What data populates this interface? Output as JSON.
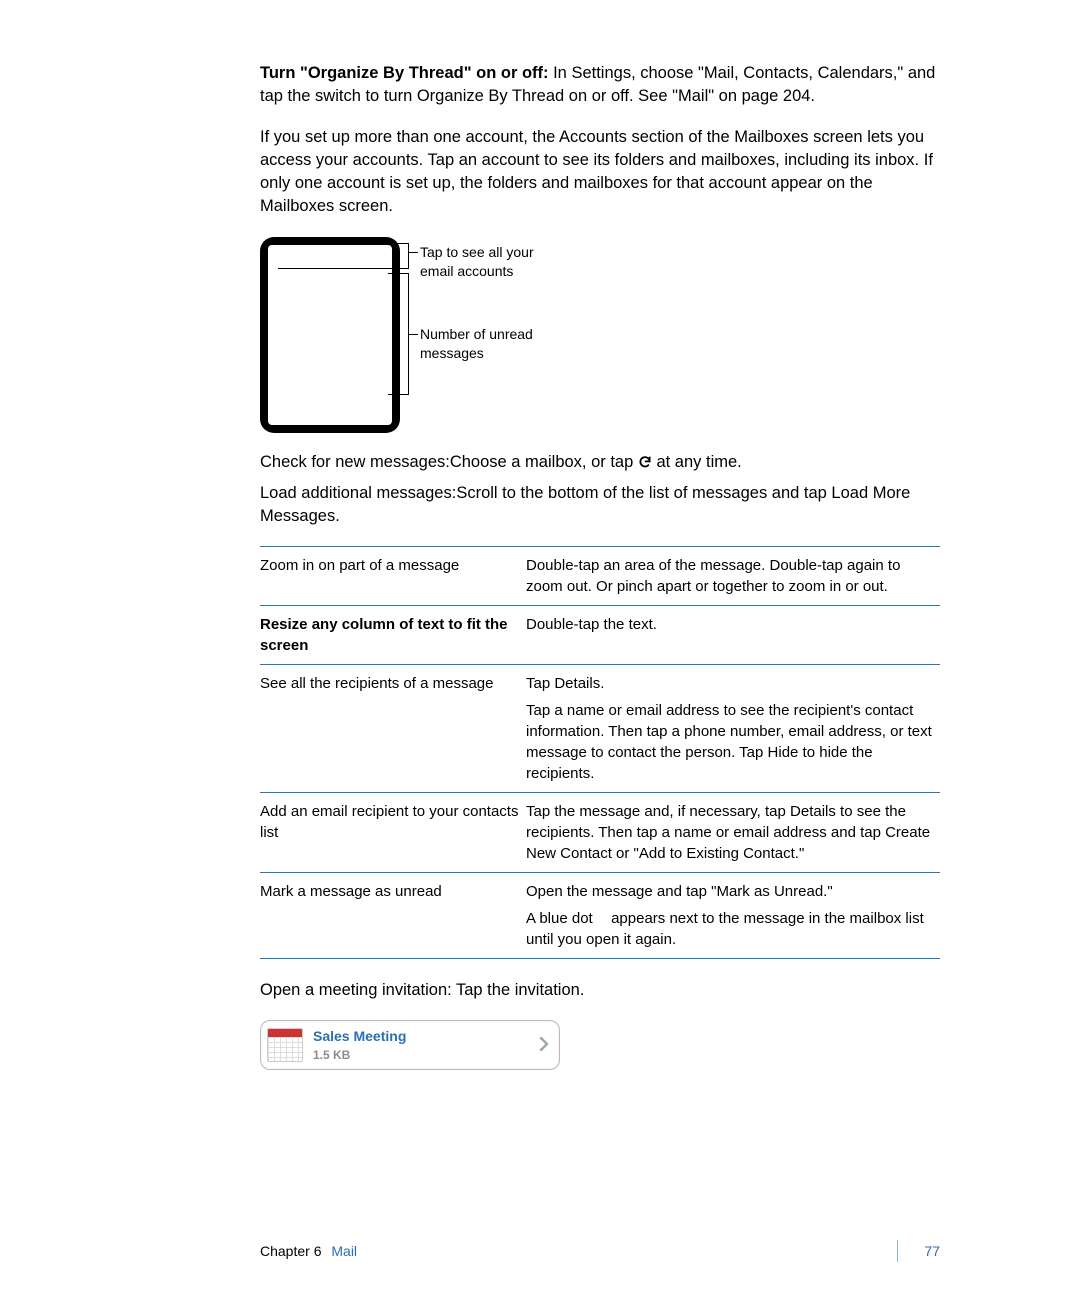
{
  "para1_lead": "Turn \"Organize By Thread\" on or off:",
  "para1_rest": "  In Settings, choose \"Mail, Contacts, Calendars,\" and tap the switch to turn Organize By Thread on or off. See \"Mail\" on page 204.",
  "para2": "If you set up more than one account, the Accounts section of the Mailboxes screen lets you access your accounts. Tap an account to see its folders and mailboxes, including its inbox. If only one account is set up, the folders and mailboxes for that account appear on the Mailboxes screen.",
  "callout1": "Tap to see all your email accounts",
  "callout2": "Number of unread messages",
  "check_lead": "Check for new messages:",
  "check_rest_a": "Choose a mailbox, or tap ",
  "check_rest_b": " at any time.",
  "load_lead": "Load additional messages:",
  "load_rest": "Scroll to the bottom of the list of messages and tap Load More Messages.",
  "table": {
    "r1c1": "Zoom in on part of a message",
    "r1c2": "Double-tap an area of the message. Double-tap again to zoom out. Or pinch apart or together to zoom in or out.",
    "r2c1": "Resize any column of text to fit the screen",
    "r2c2": "Double-tap the text.",
    "r3c1": "See all the recipients of a message",
    "r3c2a": "Tap Details.",
    "r3c2b": "Tap a name or email address to see the recipient's contact information. Then tap a phone number, email address, or text message to contact the person. Tap Hide to hide the recipients.",
    "r4c1": "Add an email recipient to your contacts list",
    "r4c2": "Tap the message and, if necessary, tap Details to see the recipients. Then tap a name or email address and tap Create New Contact or \"Add to Existing Contact.\"",
    "r5c1": "Mark a message as unread",
    "r5c2a": "Open the message and tap \"Mark as Unread.\"",
    "r5c2b_pre": "A blue dot ",
    "r5c2b_post": " appears next to the message in the mailbox list until you open it again."
  },
  "open_lead": "Open a meeting invitation:",
  "open_rest": "Tap the invitation.",
  "invite": {
    "title": "Sales Meeting",
    "size": "1.5 KB"
  },
  "footer": {
    "chapter": "Chapter 6",
    "section": "Mail",
    "page": "77"
  }
}
